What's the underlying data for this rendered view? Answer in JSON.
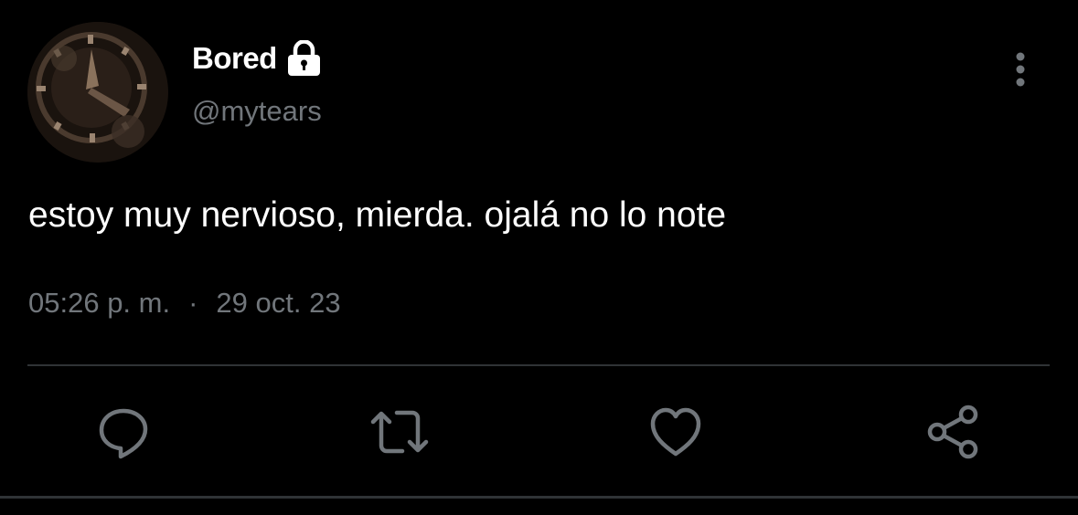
{
  "tweet": {
    "display_name": "Bored",
    "handle": "@mytears",
    "protected_icon": "lock-icon",
    "text": "estoy muy nervioso, mierda. ojalá no lo note",
    "time": "05:26 p. m.",
    "separator": "·",
    "date": "29 oct. 23"
  },
  "actions": {
    "reply": "reply-icon",
    "retweet": "retweet-icon",
    "like": "heart-icon",
    "share": "share-icon",
    "more": "more-vertical-icon"
  },
  "colors": {
    "background": "#000000",
    "primary_text": "#ffffff",
    "secondary_text": "#71767b",
    "divider": "#2f3336",
    "icon": "#71767b"
  }
}
